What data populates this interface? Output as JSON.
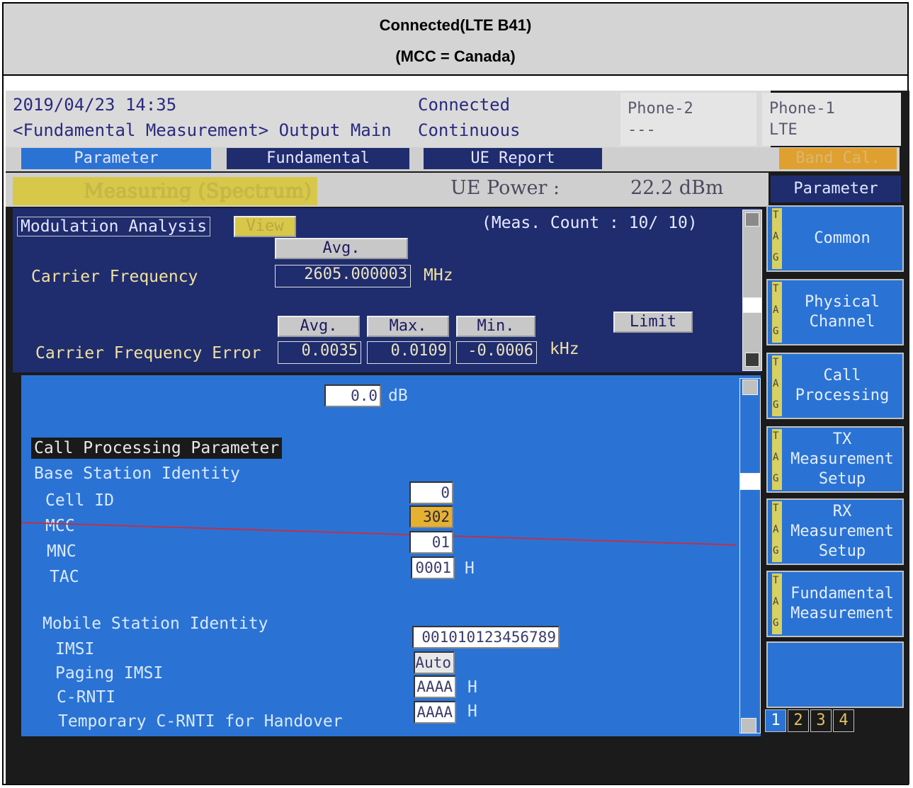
{
  "caption": {
    "line1": "Connected(LTE B41)",
    "line2": "(MCC = Canada)"
  },
  "header": {
    "datetime": "2019/04/23 14:35",
    "breadcrumb": "<Fundamental Measurement> Output Main",
    "state": "Connected",
    "mode": "Continuous",
    "phone2_label": "Phone-2",
    "phone2_value": "---",
    "phone1_label": "Phone-1",
    "phone1_value": "LTE"
  },
  "tabs": {
    "parameter": "Parameter",
    "fundamental": "Fundamental",
    "ue_report": "UE Report",
    "band_cal": "Band Cal."
  },
  "status": {
    "measuring": "Measuring (Spectrum)",
    "ue_power_label": "UE Power :",
    "ue_power_value": "22.2 dBm"
  },
  "modulation": {
    "title": "Modulation Analysis",
    "view_label": "View",
    "meas_count": "(Meas. Count :   10/   10)",
    "avg_label": "Avg.",
    "carrier_freq_label": "Carrier Frequency",
    "carrier_freq_value": "2605.000003",
    "carrier_freq_unit": "MHz",
    "err_avg_label": "Avg.",
    "err_max_label": "Max.",
    "err_min_label": "Min.",
    "limit_label": "Limit",
    "carrier_err_label": "Carrier Frequency Error",
    "err_avg": "0.0035",
    "err_max": "0.0109",
    "err_min": "-0.0006",
    "err_unit": "kHz"
  },
  "callproc": {
    "db_value": "0.0",
    "db_unit": "dB",
    "section_title": "Call Processing Parameter",
    "bsi_title": "Base Station Identity",
    "cell_id_label": "Cell ID",
    "cell_id": "0",
    "mcc_label": "MCC",
    "mcc": "302",
    "mnc_label": "MNC",
    "mnc": "01",
    "tac_label": "TAC",
    "tac": "0001",
    "tac_unit": "H",
    "msi_title": "Mobile Station Identity",
    "imsi_label": "IMSI",
    "imsi": "001010123456789",
    "paging_label": "Paging IMSI",
    "paging": "Auto",
    "crnti_label": "C-RNTI",
    "crnti": "AAAA",
    "crnti_unit": "H",
    "temp_label": "Temporary C-RNTI for Handover",
    "temp": "AAAA",
    "temp_unit": "H"
  },
  "sidemenu": {
    "header": "Parameter",
    "items": [
      "Common",
      "Physical\nChannel",
      "Call\nProcessing",
      "TX\nMeasurement\nSetup",
      "RX\nMeasurement\nSetup",
      "Fundamental\nMeasurement",
      ""
    ],
    "tag": [
      "T",
      "A",
      "G"
    ],
    "pages": [
      "1",
      "2",
      "3",
      "4"
    ]
  },
  "colors": {
    "accent_blue": "#2a73d4",
    "panel_navy": "#1f2d6e",
    "highlight_yellow": "#e6b030"
  }
}
